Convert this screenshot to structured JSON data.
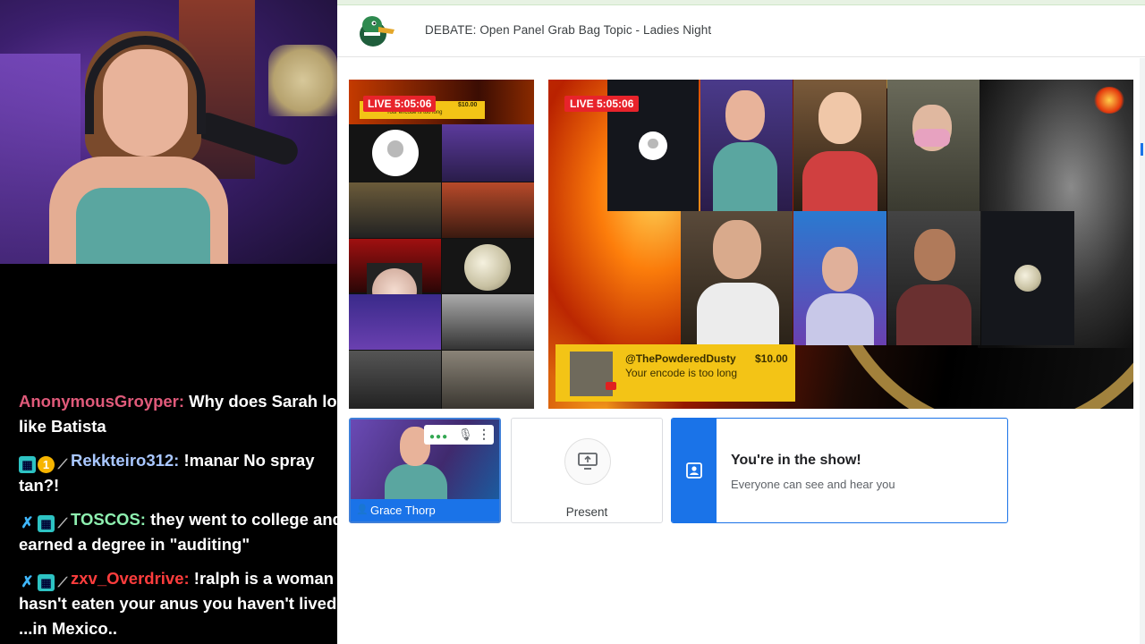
{
  "colors": {
    "accent": "#1a73e8",
    "live": "#e8232b",
    "donation": "#f3c416"
  },
  "header": {
    "title": "DEBATE: Open Panel Grab Bag Topic - Ladies Night",
    "logo_icon": "duck-logo-icon"
  },
  "preview": {
    "live_badge": "LIVE 5:05:06",
    "donation_amount": "$10.00",
    "donation_msg": "Your encode is too long",
    "donation_name": "ty"
  },
  "stage": {
    "live_badge": "LIVE 5:05:06",
    "donation": {
      "name": "@ThePowderedDusty",
      "amount": "$10.00",
      "message": "Your encode is too long"
    }
  },
  "controls": {
    "self_name": "Grace Thorp",
    "present_label": "Present",
    "in_show_title": "You're in the show!",
    "in_show_subtitle": "Everyone can see and hear you"
  },
  "chat": {
    "messages": [
      {
        "user": "AnonymousGroyper:",
        "user_color": "#e05a7a",
        "text": " Why does Sarah look like Batista",
        "badges": []
      },
      {
        "user": "Rekkteiro312:",
        "user_color": "#a9c7ff",
        "text": " !manar No spray tan?!",
        "badges": [
          "sub",
          "one",
          "pen"
        ]
      },
      {
        "user": "TOSCOS:",
        "user_color": "#8ef0b0",
        "text": " they went to college and earned a degree in \"auditing\"",
        "badges": [
          "sword",
          "sub",
          "pen"
        ]
      },
      {
        "user": "zxv_Overdrive:",
        "user_color": "#ff3d3d",
        "text": " !ralph is a woman hasn't eaten your anus you haven't lived! ...in Mexico..",
        "badges": [
          "sword",
          "sub",
          "pen"
        ]
      }
    ]
  }
}
